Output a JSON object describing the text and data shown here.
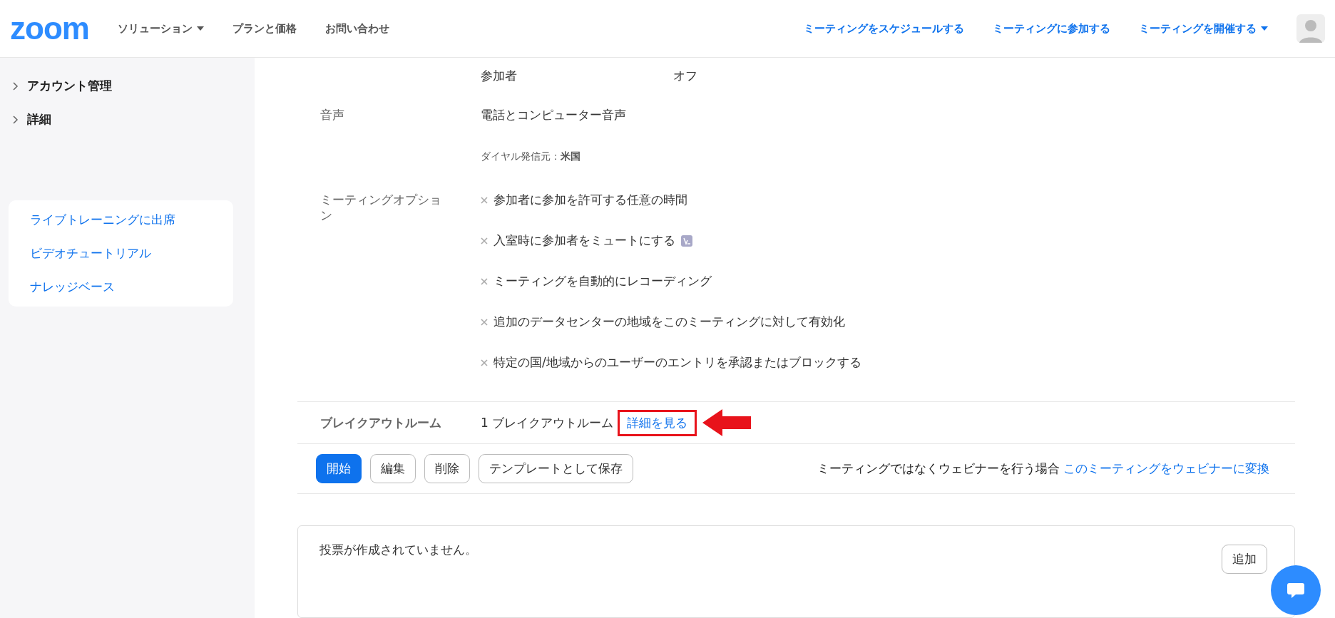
{
  "header": {
    "logo": "zoom",
    "nav": [
      {
        "label": "ソリューション",
        "dropdown": true
      },
      {
        "label": "プランと価格",
        "dropdown": false
      },
      {
        "label": "お問い合わせ",
        "dropdown": false
      }
    ],
    "actions": [
      {
        "label": "ミーティングをスケジュールする",
        "dropdown": false
      },
      {
        "label": "ミーティングに参加する",
        "dropdown": false
      },
      {
        "label": "ミーティングを開催する",
        "dropdown": true
      }
    ]
  },
  "sidebar": {
    "items": [
      {
        "label": "アカウント管理",
        "expanded": false
      },
      {
        "label": "詳細",
        "expanded": false
      }
    ],
    "help_links": [
      "ライブトレーニングに出席",
      "ビデオチュートリアル",
      "ナレッジベース"
    ]
  },
  "details": {
    "video_rows": [
      {
        "role": "参加者",
        "value": "オフ"
      }
    ],
    "audio": {
      "label": "音声",
      "value": "電話とコンピューター音声",
      "dial_label": "ダイヤル発信元：",
      "dial_value": "米国"
    },
    "options": {
      "label": "ミーティングオプション",
      "items": [
        {
          "text": "参加者に参加を許可する任意の時間",
          "enabled": false,
          "icon": false
        },
        {
          "text": "入室時に参加者をミュートにする",
          "enabled": false,
          "icon": true
        },
        {
          "text": "ミーティングを自動的にレコーディング",
          "enabled": false,
          "icon": false
        },
        {
          "text": "追加のデータセンターの地域をこのミーティングに対して有効化",
          "enabled": false,
          "icon": false
        },
        {
          "text": "特定の国/地域からのユーザーのエントリを承認またはブロックする",
          "enabled": false,
          "icon": false
        }
      ]
    },
    "breakout": {
      "label": "ブレイクアウトルーム",
      "value": "1 ブレイクアウトルーム",
      "link": "詳細を見る",
      "highlighted": true
    }
  },
  "buttons": [
    {
      "label": "開始",
      "kind": "primary"
    },
    {
      "label": "編集",
      "kind": "default"
    },
    {
      "label": "削除",
      "kind": "default"
    },
    {
      "label": "テンプレートとして保存",
      "kind": "default"
    }
  ],
  "webinar": {
    "text": "ミーティングではなくウェビナーを行う場合",
    "link": "このミーティングをウェビナーに変換"
  },
  "poll": {
    "text": "投票が作成されていません。",
    "button": "追加"
  }
}
